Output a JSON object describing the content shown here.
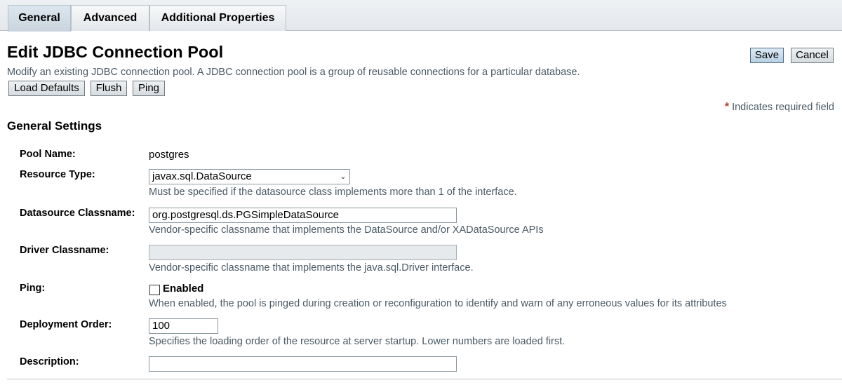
{
  "tabs": [
    "General",
    "Advanced",
    "Additional Properties"
  ],
  "page": {
    "title": "Edit JDBC Connection Pool",
    "help": "Modify an existing JDBC connection pool. A JDBC connection pool is a group of reusable connections for a particular database.",
    "required_note": "Indicates required field",
    "required_star": "*"
  },
  "actions": {
    "save": "Save",
    "cancel": "Cancel",
    "load_defaults": "Load Defaults",
    "flush": "Flush",
    "ping": "Ping"
  },
  "section": {
    "title": "General Settings"
  },
  "form": {
    "pool_name": {
      "label": "Pool Name:",
      "value": "postgres"
    },
    "resource_type": {
      "label": "Resource Type:",
      "selected": "javax.sql.DataSource",
      "hint": "Must be specified if the datasource class implements more than 1 of the interface."
    },
    "datasource_classname": {
      "label": "Datasource Classname:",
      "value": "org.postgresql.ds.PGSimpleDataSource",
      "hint": "Vendor-specific classname that implements the DataSource and/or XADataSource APIs"
    },
    "driver_classname": {
      "label": "Driver Classname:",
      "value": "",
      "hint": "Vendor-specific classname that implements the java.sql.Driver interface."
    },
    "ping": {
      "label": "Ping:",
      "checkbox_label": "Enabled",
      "checked": false,
      "hint": "When enabled, the pool is pinged during creation or reconfiguration to identify and warn of any erroneous values for its attributes"
    },
    "deployment_order": {
      "label": "Deployment Order:",
      "value": "100",
      "hint": "Specifies the loading order of the resource at server startup. Lower numbers are loaded first."
    },
    "description": {
      "label": "Description:",
      "value": ""
    }
  }
}
